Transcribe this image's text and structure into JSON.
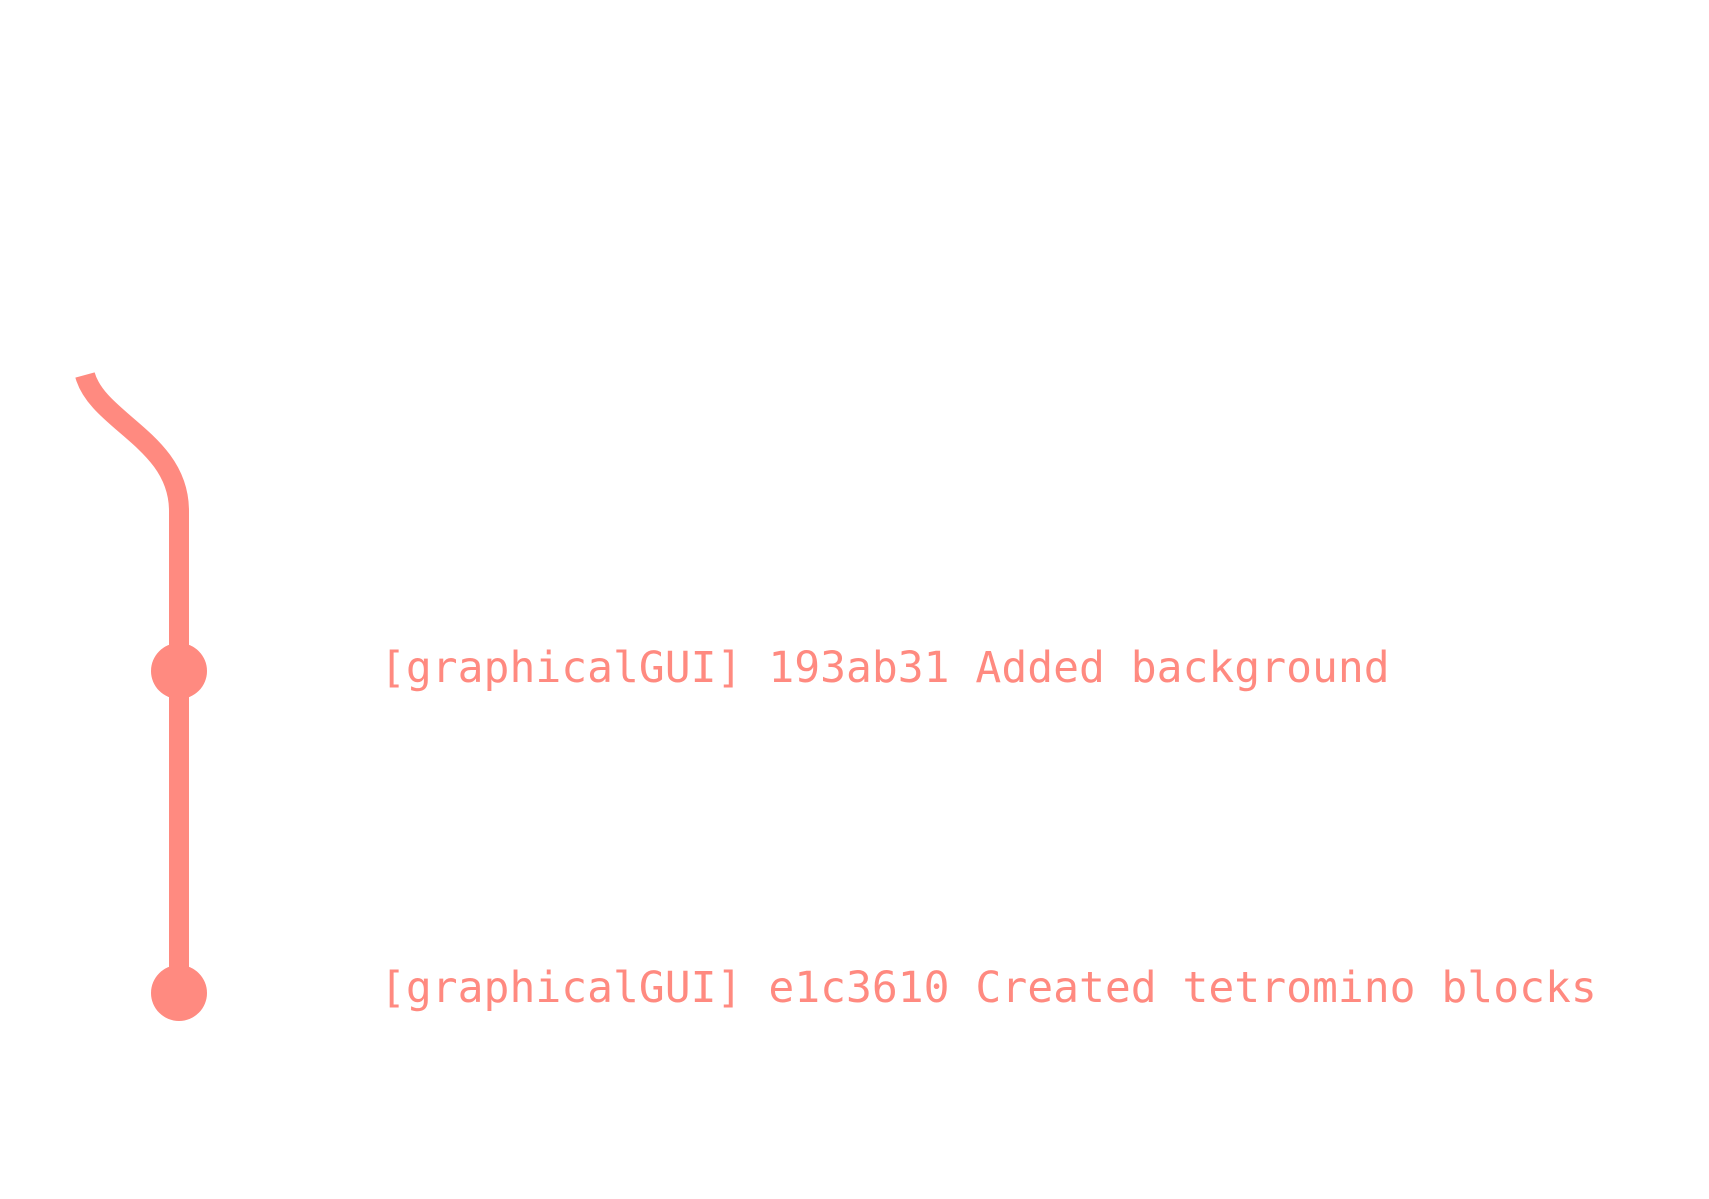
{
  "theme": {
    "branch_color": "#ff8a80",
    "background": "#ffffff"
  },
  "branch": {
    "name": "graphicalGUI"
  },
  "commits": [
    {
      "branch": "graphicalGUI",
      "hash": "193ab31",
      "message": "Added background",
      "text": "[graphicalGUI] 193ab31 Added background"
    },
    {
      "branch": "graphicalGUI",
      "hash": "e1c3610",
      "message": "Created tetromino blocks",
      "text": "[graphicalGUI] e1c3610 Created tetromino blocks"
    }
  ]
}
